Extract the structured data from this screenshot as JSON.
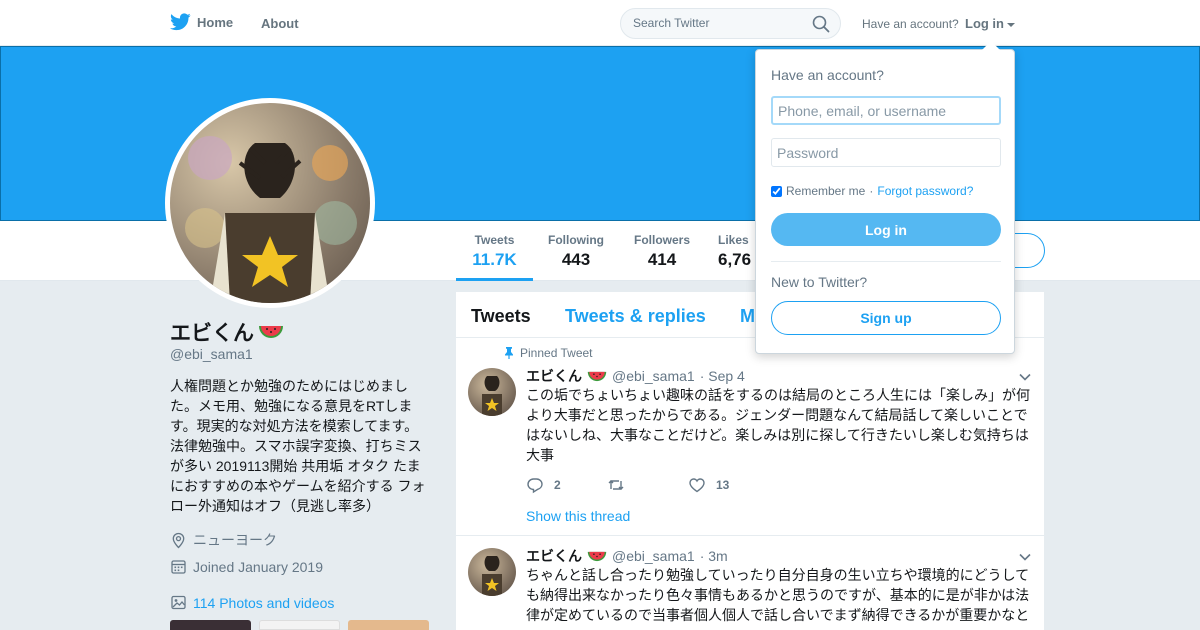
{
  "nav": {
    "home_label": "Home",
    "about_label": "About",
    "search_placeholder": "Search Twitter",
    "have_account": "Have an account?",
    "login_label": "Log in",
    "brand_color": "#1da1f2"
  },
  "profile": {
    "name": "エビくん",
    "handle": "@ebi_sama1",
    "bio": "人権問題とか勉強のためにはじめました。メモ用、勉強になる意見をRTします。現実的な対処方法を模索してます。法律勉強中。スマホ誤字変換、打ちミスが多い 2019113開始 共用垢 オタク たまにおすすめの本やゲームを紹介する フォロー外通知はオフ（見逃し率多）",
    "location": "ニューヨーク",
    "joined": "Joined January 2019",
    "photos_videos": "114 Photos and videos"
  },
  "stats": [
    {
      "label": "Tweets",
      "value": "11.7K"
    },
    {
      "label": "Following",
      "value": "443"
    },
    {
      "label": "Followers",
      "value": "414"
    },
    {
      "label": "Likes",
      "value": "6,76"
    }
  ],
  "tabs": [
    "Tweets",
    "Tweets & replies",
    "M"
  ],
  "tweets": [
    {
      "pinned_label": "Pinned Tweet",
      "name": "エビくん",
      "handle": "@ebi_sama1",
      "time": "· Sep 4",
      "text": "この垢でちょいちょい趣味の話をするのは結局のところ人生には「楽しみ」が何より大事だと思ったからである。ジェンダー問題なんて結局話して楽しいことではないしね、大事なことだけど。楽しみは別に探して行きたいし楽しむ気持ちは大事",
      "replies": "2",
      "retweets": "",
      "likes": "13",
      "show_thread": "Show this thread"
    },
    {
      "name": "エビくん",
      "handle": "@ebi_sama1",
      "time": "· 3m",
      "text": "ちゃんと話し合ったり勉強していったり自分自身の生い立ちや環境的にどうしても納得出来なかったり色々事情もあるかと思うのですが、基本的に是が非かは法律が定めているので当事者個人個人で話し合いでまず納得できるかが重要かなと"
    }
  ],
  "login_dropdown": {
    "title": "Have an account?",
    "username_placeholder": "Phone, email, or username",
    "password_placeholder": "Password",
    "remember_label": "Remember me",
    "separator": "·",
    "forgot_label": "Forgot password?",
    "login_button": "Log in",
    "new_to_twitter": "New to Twitter?",
    "signup_button": "Sign up"
  }
}
